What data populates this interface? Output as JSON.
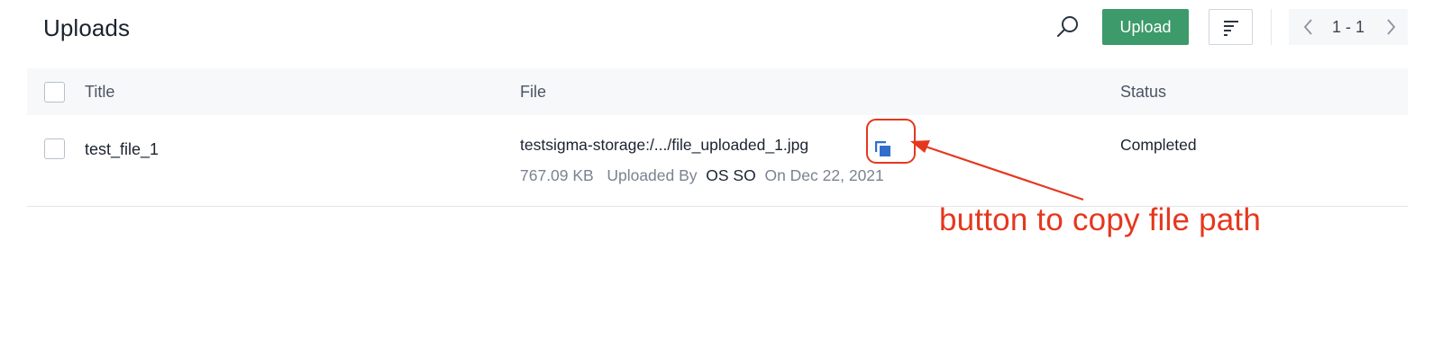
{
  "header": {
    "title": "Uploads",
    "search_icon": "search-icon",
    "upload_label": "Upload",
    "sort_icon": "sort-lines-icon",
    "pagination": {
      "range": "1 - 1",
      "prev_icon": "chevron-left-icon",
      "next_icon": "chevron-right-icon"
    }
  },
  "table": {
    "columns": [
      "Title",
      "File",
      "Status"
    ],
    "rows": [
      {
        "title": "test_file_1",
        "file_path": "testsigma-storage:/.../file_uploaded_1.jpg",
        "size": "767.09 KB",
        "uploaded_by_label": "Uploaded By",
        "uploader": "OS SO",
        "date": "On Dec 22, 2021",
        "status": "Completed",
        "copy_icon": "copy-icon"
      }
    ]
  },
  "annotation": {
    "text": "button to copy file path",
    "color": "#e5371e"
  },
  "colors": {
    "primary_button": "#3d9a6a",
    "copy_icon": "#2f6fcb",
    "header_bg": "#f7f8fa"
  }
}
